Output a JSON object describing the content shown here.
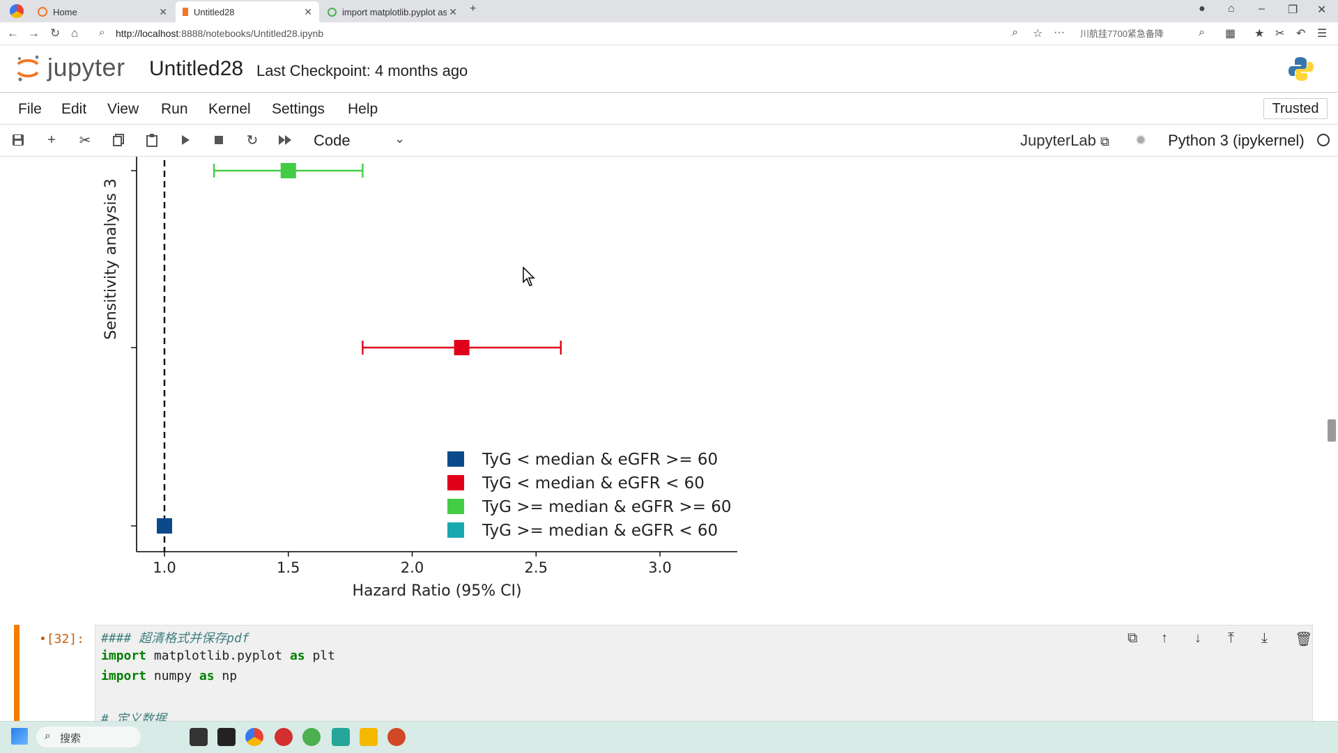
{
  "browser": {
    "tabs": [
      {
        "label": "Home"
      },
      {
        "label": "Untitled28"
      },
      {
        "label": "import matplotlib.pyplot as"
      }
    ],
    "url_host": "http://localhost",
    "url_path": ":8888/notebooks/Untitled28.ipynb",
    "search_text": "川航挂7700紧急备降"
  },
  "jupyter": {
    "wordmark": "jupyter",
    "notebook_title": "Untitled28",
    "checkpoint": "Last Checkpoint: 4 months ago",
    "menu": [
      "File",
      "Edit",
      "View",
      "Run",
      "Kernel",
      "Settings",
      "Help"
    ],
    "trusted": "Trusted",
    "cell_type": "Code",
    "jupyterlab_link": "JupyterLab",
    "kernel": "Python 3 (ipykernel)"
  },
  "chart_data": {
    "type": "scatter",
    "ylabel": "Sensitivity analysis 3",
    "xlabel": "Hazard Ratio (95% CI)",
    "xlim": [
      0.9,
      3.3
    ],
    "xticks": [
      "1.0",
      "1.5",
      "2.0",
      "2.5",
      "3.0"
    ],
    "reference_line": 1.0,
    "series": [
      {
        "name": "TyG < median & eGFR >= 60",
        "color": "#0a4a8a",
        "hr": 1.0,
        "low": 1.0,
        "high": 1.0,
        "row": 1
      },
      {
        "name": "TyG < median & eGFR < 60",
        "color": "#e0001a",
        "hr": 2.2,
        "low": 1.8,
        "high": 2.6,
        "row": 2
      },
      {
        "name": "TyG >= median & eGFR >= 60",
        "color": "#44cc44",
        "hr": 1.5,
        "low": 1.2,
        "high": 1.8,
        "row": 3
      },
      {
        "name": "TyG >= median & eGFR < 60",
        "color": "#17a8b0",
        "row": 4
      }
    ],
    "legend": "lower-right"
  },
  "cell": {
    "prompt": "•[32]:",
    "lines": [
      {
        "t": "comment",
        "text": "#### 超清格式并保存pdf"
      },
      {
        "t": "import",
        "kw": "import",
        "mod": " matplotlib.pyplot ",
        "as": "as",
        "alias": " plt"
      },
      {
        "t": "import",
        "kw": "import",
        "mod": " numpy ",
        "as": "as",
        "alias": " np"
      },
      {
        "t": "blank",
        "text": ""
      },
      {
        "t": "comment",
        "text": "# 定义数据"
      }
    ]
  },
  "taskbar": {
    "search_label": "搜索"
  }
}
